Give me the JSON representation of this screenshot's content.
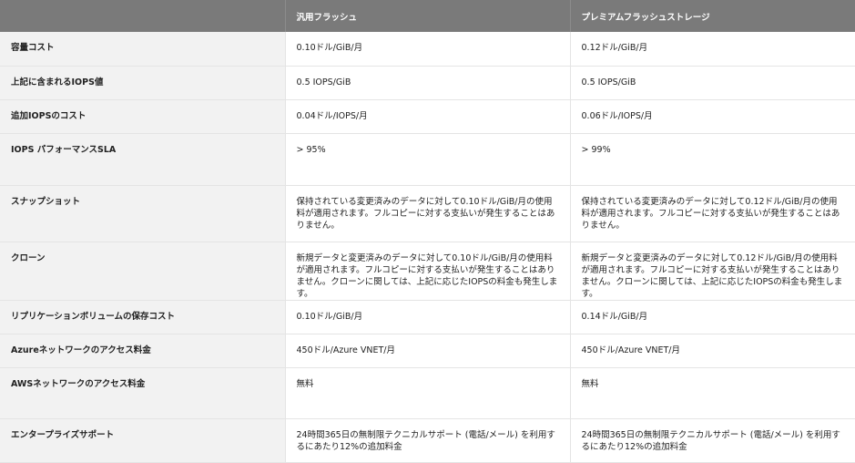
{
  "table": {
    "headers": [
      "",
      "汎用フラッシュ",
      "プレミアムフラッシュストレージ"
    ],
    "rows": [
      {
        "label": "容量コスト",
        "general": "0.10ドル/GiB/月",
        "premium": "0.12ドル/GiB/月"
      },
      {
        "label": "上記に含まれるIOPS値",
        "general": "0.5 IOPS/GiB",
        "premium": "0.5 IOPS/GiB"
      },
      {
        "label": "追加IOPSのコスト",
        "general": "0.04ドル/IOPS/月",
        "premium": "0.06ドル/IOPS/月"
      },
      {
        "label": "IOPS パフォーマンスSLA",
        "general": "> 95%",
        "premium": "> 99%"
      },
      {
        "label": "スナップショット",
        "general": "保持されている変更済みのデータに対して0.10ドル/GiB/月の使用料が適用されます。フルコピーに対する支払いが発生することはありません。",
        "premium": "保持されている変更済みのデータに対して0.12ドル/GiB/月の使用料が適用されます。フルコピーに対する支払いが発生することはありません。"
      },
      {
        "label": "クローン",
        "general": "新規データと変更済みのデータに対して0.10ドル/GiB/月の使用料が適用されます。フルコピーに対する支払いが発生することはありません。クローンに関しては、上記に応じたIOPSの料金も発生します。",
        "premium": "新規データと変更済みのデータに対して0.12ドル/GiB/月の使用料が適用されます。フルコピーに対する支払いが発生することはありません。クローンに関しては、上記に応じたIOPSの料金も発生します。"
      },
      {
        "label": "リプリケーションボリュームの保存コスト",
        "general": "0.10ドル/GiB/月",
        "premium": "0.14ドル/GiB/月"
      },
      {
        "label": "Azureネットワークのアクセス料金",
        "general": "450ドル/Azure VNET/月",
        "premium": "450ドル/Azure VNET/月"
      },
      {
        "label": "AWSネットワークのアクセス料金",
        "general": "無料",
        "premium": "無料"
      },
      {
        "label": "エンタープライズサポート",
        "general": "24時間365日の無制限テクニカルサポート (電話/メール) を利用するにあたり12%の追加料金",
        "premium": "24時間365日の無制限テクニカルサポート (電話/メール) を利用するにあたり12%の追加料金"
      }
    ]
  }
}
